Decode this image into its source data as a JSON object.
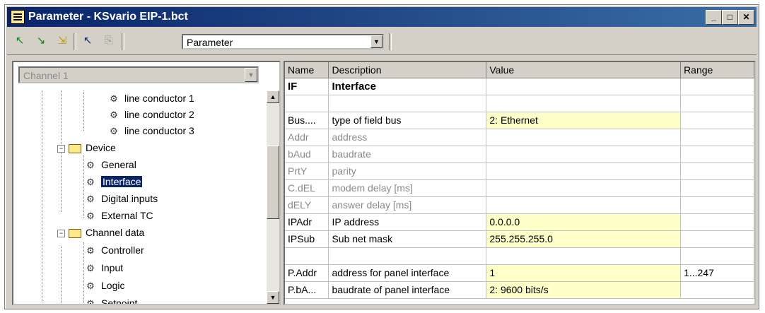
{
  "window": {
    "title": "Parameter - KSvario EIP-1.bct"
  },
  "toolbar": {
    "buttons": [
      "arrow-up-icon",
      "arrow-down-icon",
      "arrow-diagonal-icon",
      "info-icon",
      "copy-icon"
    ],
    "combo_value": "Parameter"
  },
  "left": {
    "channel_combo": "Channel 1",
    "tree": {
      "lc1": "line conductor 1",
      "lc2": "line conductor 2",
      "lc3": "line conductor 3",
      "device": "Device",
      "general": "General",
      "interface": "Interface",
      "digital_inputs": "Digital inputs",
      "external_tc": "External TC",
      "channel_data": "Channel data",
      "controller": "Controller",
      "input": "Input",
      "logic": "Logic",
      "setpoint": "Setpoint"
    }
  },
  "table": {
    "headers": {
      "name": "Name",
      "description": "Description",
      "value": "Value",
      "range": "Range"
    },
    "group": {
      "name": "IF",
      "description": "Interface"
    },
    "rows": [
      {
        "name": "Bus....",
        "description": "type of field bus",
        "value": "2: Ethernet",
        "range": ""
      },
      {
        "name": "Addr",
        "description": "address",
        "value": "",
        "range": ""
      },
      {
        "name": "bAud",
        "description": "baudrate",
        "value": "",
        "range": ""
      },
      {
        "name": "PrtY",
        "description": "parity",
        "value": "",
        "range": ""
      },
      {
        "name": "C.dEL",
        "description": "modem delay [ms]",
        "value": "",
        "range": ""
      },
      {
        "name": "dELY",
        "description": "answer delay [ms]",
        "value": "",
        "range": ""
      },
      {
        "name": "IPAdr",
        "description": "IP address",
        "value": "0.0.0.0",
        "range": ""
      },
      {
        "name": "IPSub",
        "description": "Sub net mask",
        "value": "255.255.255.0",
        "range": ""
      },
      {
        "name": "P.Addr",
        "description": "address for panel interface",
        "value": "1",
        "range": "1...247"
      },
      {
        "name": "P.bA...",
        "description": "baudrate of panel interface",
        "value": "2: 9600 bits/s",
        "range": ""
      }
    ]
  },
  "colors": {
    "title_bar": "#0a246a",
    "editable_value": "#ffffc8",
    "selection": "#0a246a"
  }
}
